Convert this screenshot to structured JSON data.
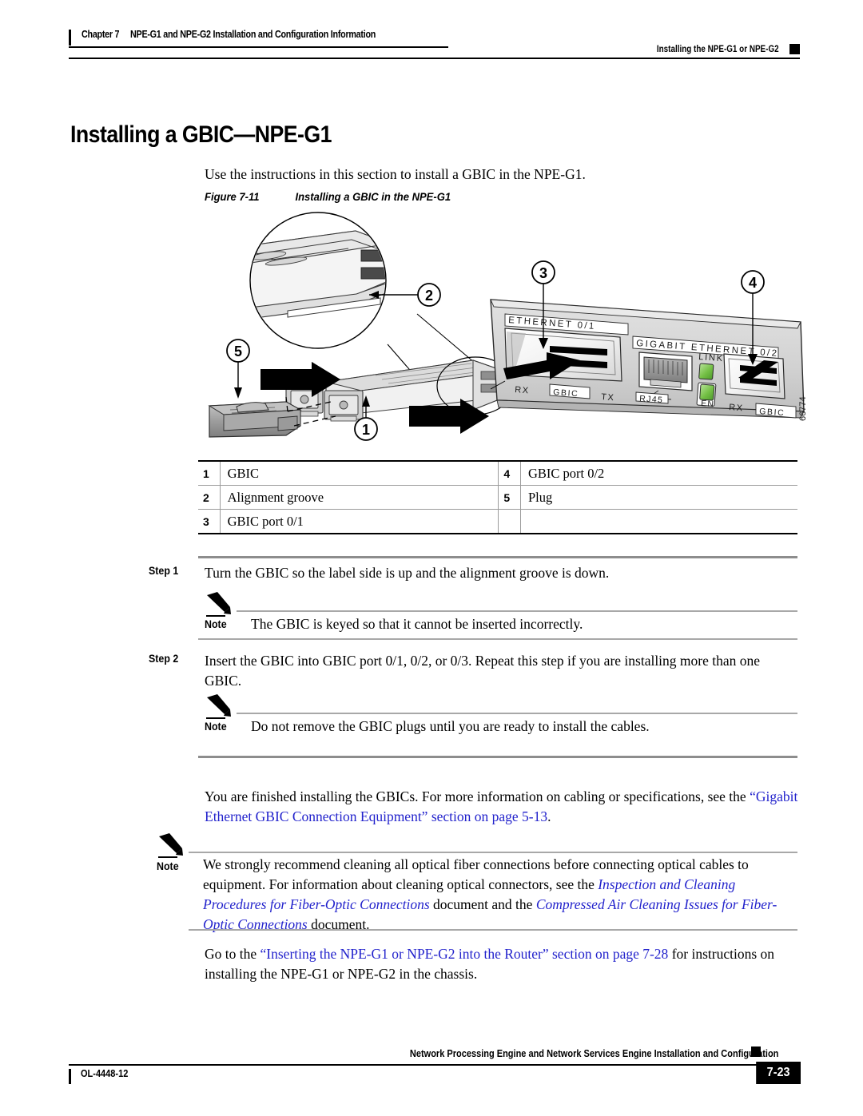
{
  "header": {
    "chapter_num": "Chapter 7",
    "chapter_title": "NPE-G1 and NPE-G2 Installation and Configuration Information",
    "section_title": "Installing the NPE-G1 or NPE-G2"
  },
  "title": "Installing a GBIC—NPE-G1",
  "intro": "Use the instructions in this section to install a GBIC in the NPE-G1.",
  "figure": {
    "number": "Figure 7-11",
    "caption": "Installing a GBIC in the NPE-G1",
    "art_id": "66774",
    "callouts": [
      "1",
      "2",
      "3",
      "4",
      "5"
    ],
    "faceplate_labels": {
      "ethernet_port1": "ETHERNET 0/1",
      "gigabit_ethernet_port2": "GIGABIT ETHERNET 0/2",
      "rx_left": "RX",
      "gbic_left": "GBIC",
      "tx_left": "TX",
      "rj45": "RJ45",
      "link_led": "LINK",
      "en_led": "EN",
      "rx_right": "RX",
      "gbic_right": "GBIC"
    }
  },
  "legend": {
    "rows": [
      {
        "num_left": "1",
        "text_left": "GBIC",
        "num_right": "4",
        "text_right": "GBIC port 0/2"
      },
      {
        "num_left": "2",
        "text_left": "Alignment groove",
        "num_right": "5",
        "text_right": "Plug"
      },
      {
        "num_left": "3",
        "text_left": "GBIC port 0/1",
        "num_right": "",
        "text_right": ""
      }
    ]
  },
  "steps": [
    {
      "label": "Step 1",
      "text": "Turn the GBIC so the label side is up and the alignment groove is down.",
      "note_label": "Note",
      "note_text": "The GBIC is keyed so that it cannot be inserted incorrectly."
    },
    {
      "label": "Step 2",
      "text": "Insert the GBIC into GBIC port 0/1, 0/2, or 0/3. Repeat this step if you are installing more than one GBIC.",
      "note_label": "Note",
      "note_text": "Do not remove the GBIC plugs until you are ready to install the cables."
    }
  ],
  "closing": {
    "para1_pre": "You are finished installing the GBICs. For more information on cabling or specifications, see the ",
    "para1_link": "“Gigabit Ethernet GBIC Connection Equipment” section on page 5-13",
    "para1_post": ".",
    "note_label": "Note",
    "note_pre": "We strongly recommend cleaning all optical fiber connections before connecting optical cables to equipment. For information about cleaning optical connectors, see the ",
    "note_link1": "Inspection and Cleaning Procedures for Fiber-Optic Connections",
    "note_mid": " document and the ",
    "note_link2": "Compressed Air Cleaning Issues for Fiber-Optic Connections",
    "note_post": " document.",
    "para2_pre": "Go to the ",
    "para2_link": "“Inserting the NPE-G1 or NPE-G2 into the Router” section on page 7-28",
    "para2_post": " for instructions on installing the NPE-G1 or NPE-G2 in the chassis."
  },
  "footer": {
    "doc_title": "Network Processing Engine and Network Services Engine Installation and Configuration",
    "doc_id": "OL-4448-12",
    "page_number": "7-23"
  },
  "colors": {
    "link": "#2222cc",
    "led_green": "#74c045",
    "rule_grey": "#8d8d8d",
    "panel_grey": "#d8d8d8"
  }
}
